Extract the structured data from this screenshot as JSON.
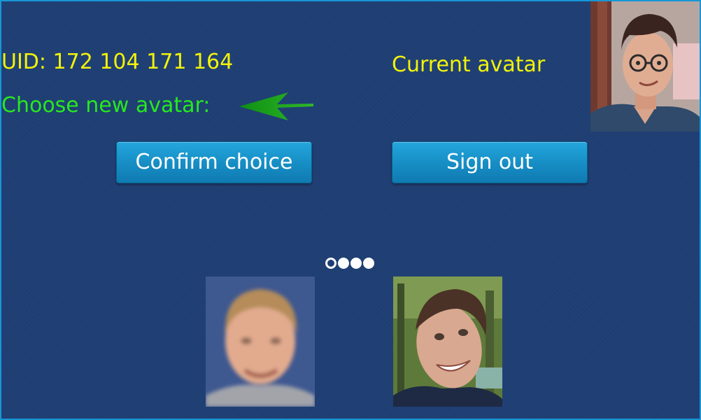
{
  "user": {
    "uid_text": "UID: 172 104 171 164"
  },
  "labels": {
    "choose_new_avatar": "Choose new avatar:",
    "current_avatar": "Current avatar"
  },
  "buttons": {
    "confirm": "Confirm choice",
    "sign_out": "Sign out"
  },
  "carousel": {
    "pages": 4,
    "active_page": 1,
    "options": [
      {
        "icon": "photo-blurred-blond-young-man"
      },
      {
        "icon": "photo-smiling-young-man-outdoors"
      }
    ]
  },
  "current_avatar": {
    "icon": "photo-young-man-glasses"
  },
  "colors": {
    "background": "#1f3f74",
    "border": "#1796d6",
    "uid_text": "#f2f20a",
    "choose_text": "#27e81f",
    "arrow": "#1fa51f",
    "button_top": "#23a6dc",
    "button_bottom": "#0f7ab1",
    "button_text": "#ffffff"
  }
}
